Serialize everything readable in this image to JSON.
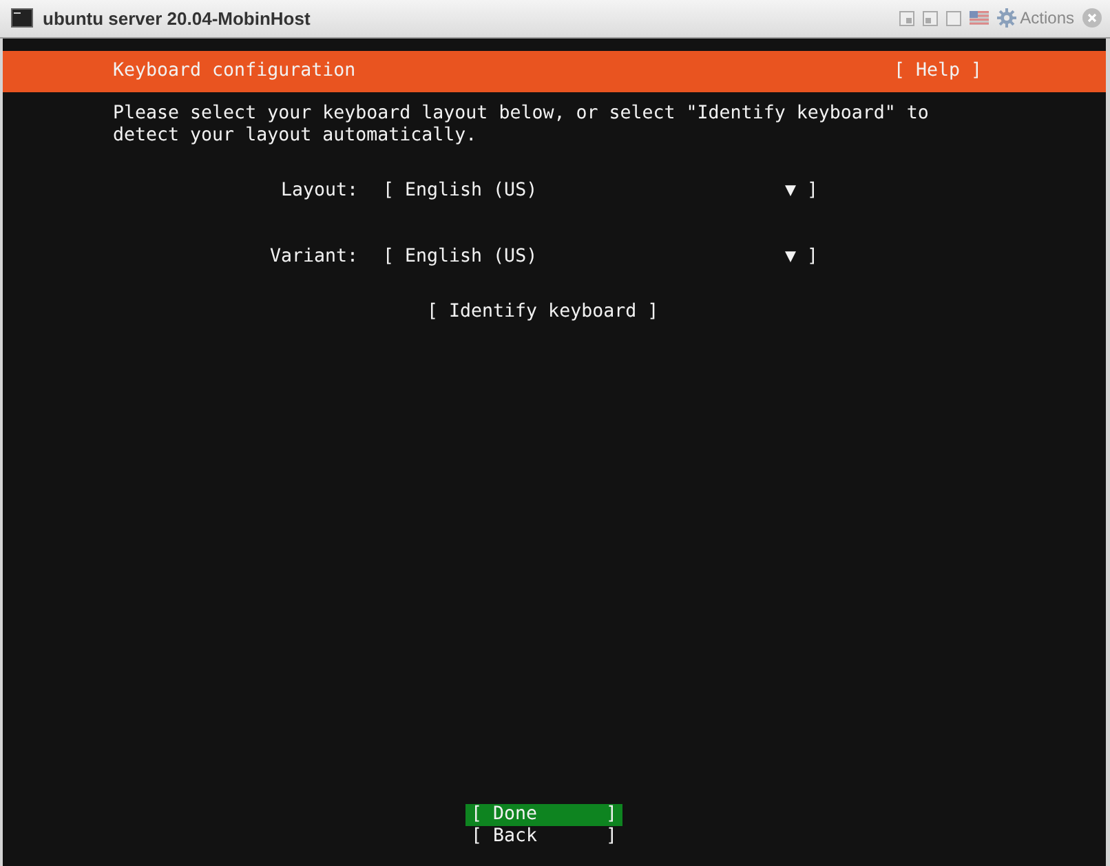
{
  "window": {
    "title": "ubuntu server 20.04-MobinHost",
    "actions_label": "Actions"
  },
  "header": {
    "title": "Keyboard configuration",
    "help": {
      "open": "[",
      "label": "Help",
      "close": "]"
    }
  },
  "intro": "Please select your keyboard layout below, or select \"Identify keyboard\" to detect your layout automatically.",
  "fields": [
    {
      "label": "Layout:",
      "open": "[",
      "value": "English (US)",
      "caret": "▼",
      "close": "]"
    },
    {
      "label": "Variant:",
      "open": "[",
      "value": "English (US)",
      "caret": "▼",
      "close": "]"
    }
  ],
  "identify_button": {
    "open": "[",
    "label": "Identify keyboard",
    "close": "]"
  },
  "buttons": [
    {
      "open": "[",
      "label": "Done",
      "close": "]",
      "selected": true
    },
    {
      "open": "[",
      "label": "Back",
      "close": "]",
      "selected": false
    }
  ]
}
